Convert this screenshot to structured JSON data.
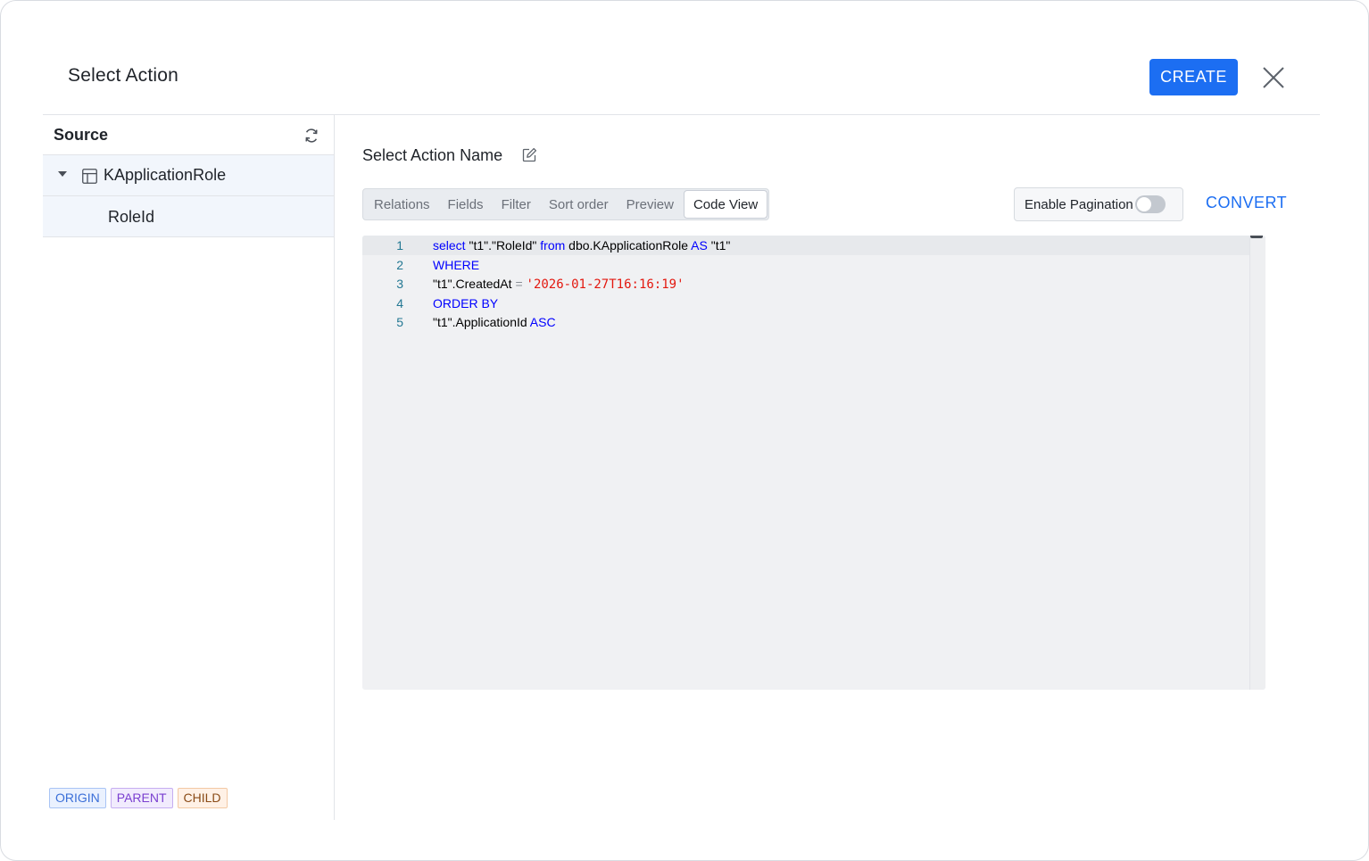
{
  "dialog": {
    "title": "Select Action",
    "create_label": "CREATE",
    "close_icon": "close-icon"
  },
  "sidebar": {
    "title": "Source",
    "refresh_icon": "refresh-icon",
    "tree": {
      "root_label": "KApplicationRole",
      "root_icon": "table-icon",
      "expanded": true,
      "children": [
        {
          "label": "RoleId"
        }
      ]
    },
    "legend": [
      {
        "label": "ORIGIN",
        "color": "#3b6fd8"
      },
      {
        "label": "PARENT",
        "color": "#7a3fd0"
      },
      {
        "label": "CHILD",
        "color": "#8a4b17"
      }
    ]
  },
  "main": {
    "action_name": "Select Action Name",
    "tabs": [
      {
        "label": "Relations",
        "active": false
      },
      {
        "label": "Fields",
        "active": false
      },
      {
        "label": "Filter",
        "active": false
      },
      {
        "label": "Sort order",
        "active": false
      },
      {
        "label": "Preview",
        "active": false
      },
      {
        "label": "Code View",
        "active": true
      }
    ],
    "pagination": {
      "label": "Enable Pagination",
      "enabled": false
    },
    "convert_label": "CONVERT",
    "code": {
      "lines": [
        {
          "no": "1",
          "tokens": [
            {
              "t": "select",
              "k": "kw"
            },
            {
              "t": " \"t1\".\"RoleId\" ",
              "k": ""
            },
            {
              "t": "from",
              "k": "kw"
            },
            {
              "t": " dbo.KApplicationRole ",
              "k": ""
            },
            {
              "t": "AS",
              "k": "kw"
            },
            {
              "t": " \"t1\"",
              "k": ""
            }
          ]
        },
        {
          "no": "2",
          "tokens": [
            {
              "t": "WHERE",
              "k": "kw"
            }
          ]
        },
        {
          "no": "3",
          "tokens": [
            {
              "t": "\"t1\".CreatedAt ",
              "k": ""
            },
            {
              "t": "=",
              "k": "op"
            },
            {
              "t": " ",
              "k": ""
            },
            {
              "t": "'2026-01-27T16:16:19'",
              "k": "str"
            }
          ]
        },
        {
          "no": "4",
          "tokens": [
            {
              "t": "ORDER BY",
              "k": "kw"
            }
          ]
        },
        {
          "no": "5",
          "tokens": [
            {
              "t": "\"t1\".ApplicationId ",
              "k": ""
            },
            {
              "t": "ASC",
              "k": "kw"
            }
          ]
        }
      ]
    }
  }
}
